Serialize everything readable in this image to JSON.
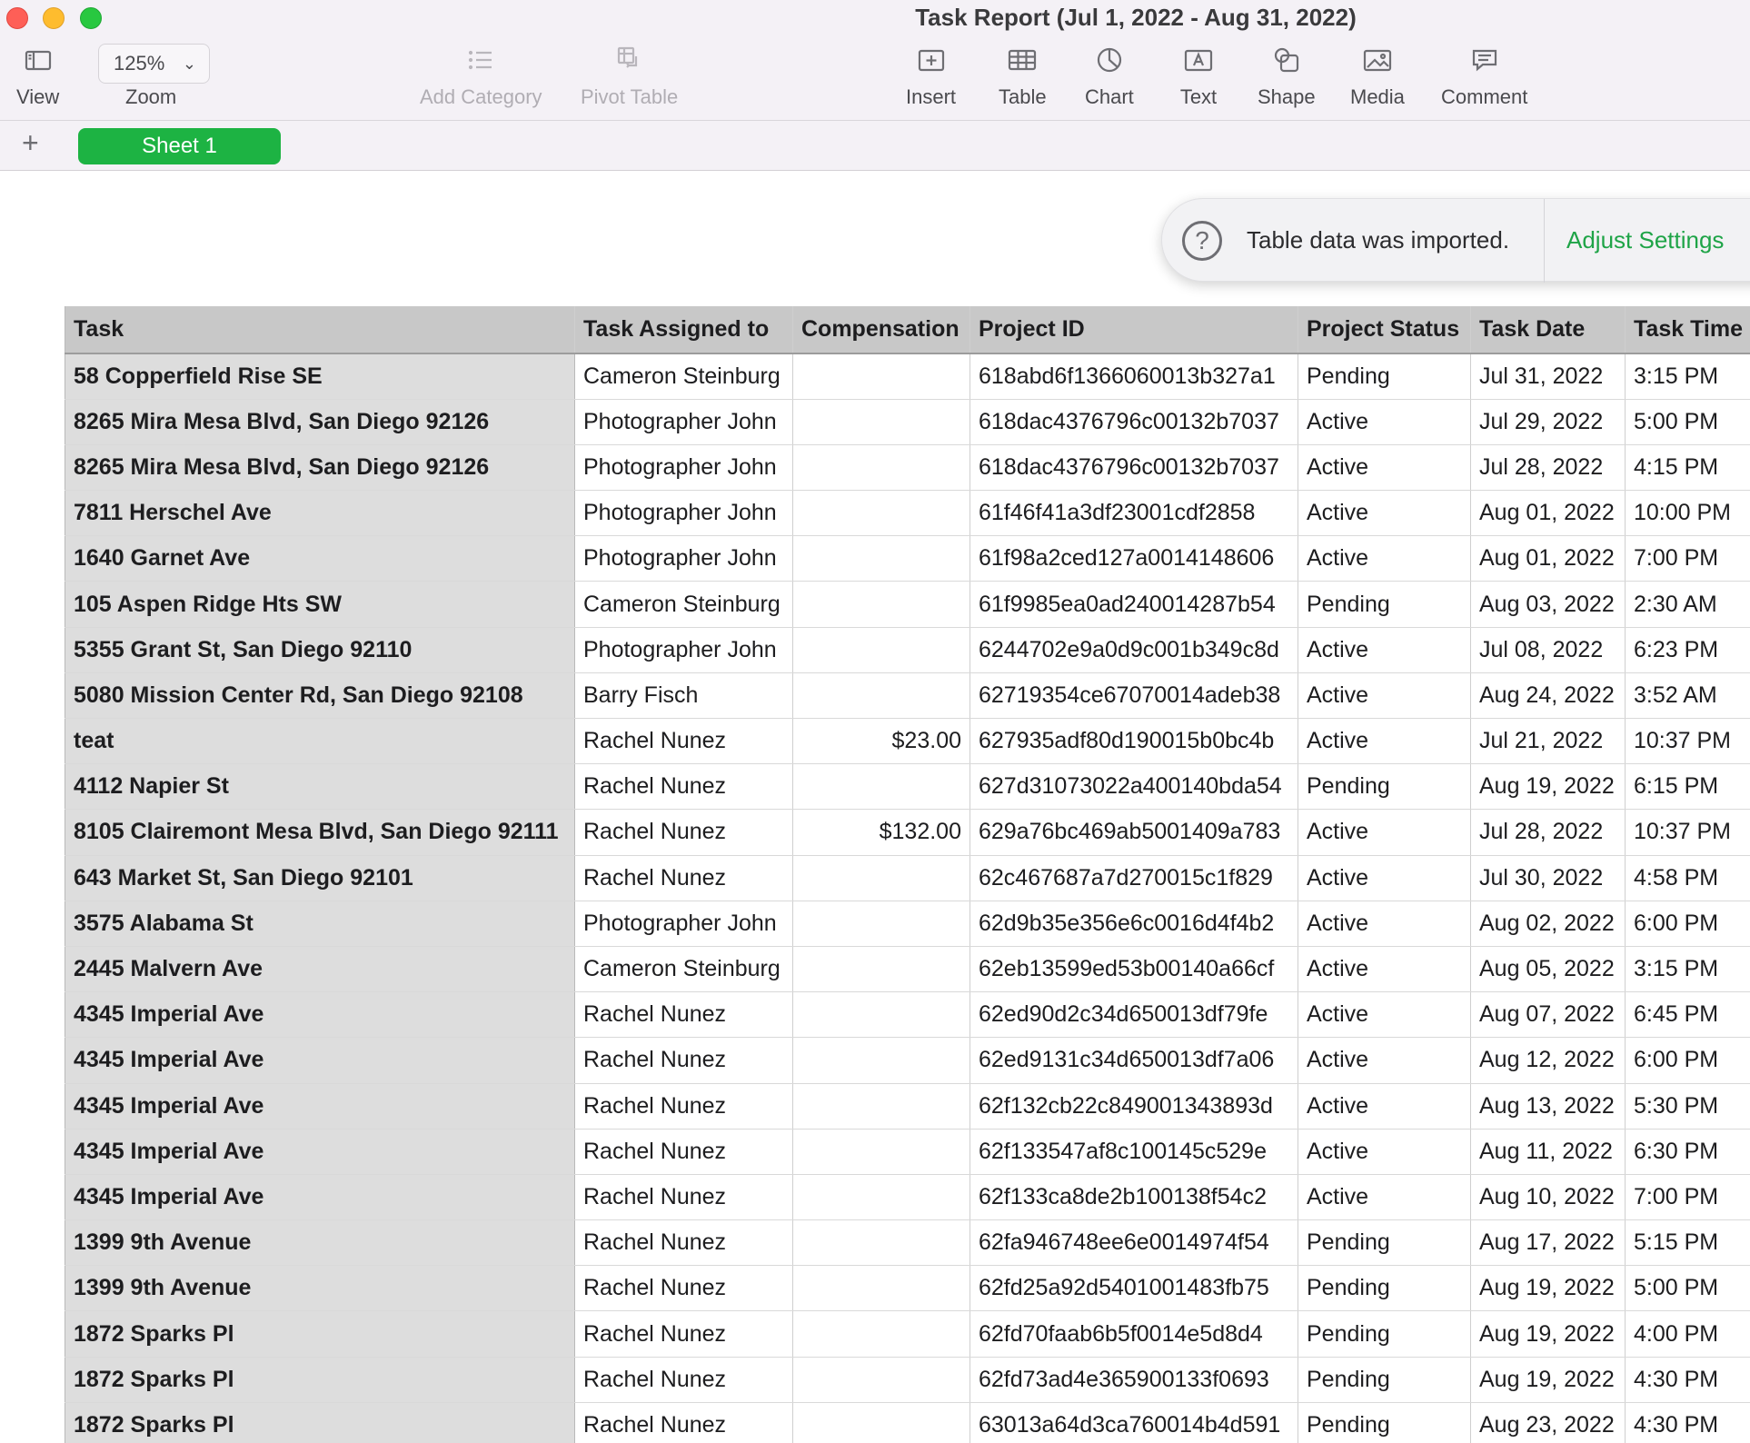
{
  "window": {
    "title": "Task Report (Jul 1, 2022 - Aug 31, 2022)"
  },
  "toolbar": {
    "view_label": "View",
    "zoom_value": "125%",
    "zoom_label": "Zoom",
    "add_category_label": "Add Category",
    "pivot_table_label": "Pivot Table",
    "insert_label": "Insert",
    "table_label": "Table",
    "chart_label": "Chart",
    "text_label": "Text",
    "shape_label": "Shape",
    "media_label": "Media",
    "comment_label": "Comment"
  },
  "sheets": {
    "add_symbol": "+",
    "active_tab": "Sheet 1",
    "active_color": "#1db343"
  },
  "notice": {
    "icon": "?",
    "message": "Table data was imported.",
    "action": "Adjust Settings"
  },
  "table": {
    "headers": [
      "Task",
      "Task Assigned to",
      "Compensation",
      "Project ID",
      "Project Status",
      "Task Date",
      "Task Time"
    ],
    "rows": [
      [
        "58 Copperfield Rise SE",
        "Cameron Steinburg",
        "",
        "618abd6f1366060013b327a1",
        "Pending",
        "Jul 31, 2022",
        "3:15 PM"
      ],
      [
        "8265 Mira Mesa Blvd, San Diego 92126",
        "Photographer John",
        "",
        "618dac4376796c00132b7037",
        "Active",
        "Jul 29, 2022",
        "5:00 PM"
      ],
      [
        "8265 Mira Mesa Blvd, San Diego 92126",
        "Photographer John",
        "",
        "618dac4376796c00132b7037",
        "Active",
        "Jul 28, 2022",
        "4:15 PM"
      ],
      [
        "7811 Herschel Ave",
        "Photographer John",
        "",
        "61f46f41a3df23001cdf2858",
        "Active",
        "Aug 01, 2022",
        "10:00 PM"
      ],
      [
        "1640 Garnet Ave",
        "Photographer John",
        "",
        "61f98a2ced127a0014148606",
        "Active",
        "Aug 01, 2022",
        "7:00 PM"
      ],
      [
        "105 Aspen Ridge Hts SW",
        "Cameron Steinburg",
        "",
        "61f9985ea0ad240014287b54",
        "Pending",
        "Aug 03, 2022",
        "2:30 AM"
      ],
      [
        "5355 Grant St, San Diego 92110",
        "Photographer John",
        "",
        "6244702e9a0d9c001b349c8d",
        "Active",
        "Jul 08, 2022",
        "6:23 PM"
      ],
      [
        "5080 Mission Center Rd, San Diego 92108",
        "Barry Fisch",
        "",
        "62719354ce67070014adeb38",
        "Active",
        "Aug 24, 2022",
        "3:52 AM"
      ],
      [
        "teat",
        "Rachel Nunez",
        "$23.00",
        "627935adf80d190015b0bc4b",
        "Active",
        "Jul 21, 2022",
        "10:37 PM"
      ],
      [
        "4112 Napier St",
        "Rachel Nunez",
        "",
        "627d31073022a400140bda54",
        "Pending",
        "Aug 19, 2022",
        "6:15 PM"
      ],
      [
        "8105 Clairemont Mesa Blvd, San Diego 92111",
        "Rachel Nunez",
        "$132.00",
        "629a76bc469ab5001409a783",
        "Active",
        "Jul 28, 2022",
        "10:37 PM"
      ],
      [
        "643 Market St, San Diego 92101",
        "Rachel Nunez",
        "",
        "62c467687a7d270015c1f829",
        "Active",
        "Jul 30, 2022",
        "4:58 PM"
      ],
      [
        "3575 Alabama St",
        "Photographer John",
        "",
        "62d9b35e356e6c0016d4f4b2",
        "Active",
        "Aug 02, 2022",
        "6:00 PM"
      ],
      [
        "2445 Malvern Ave",
        "Cameron Steinburg",
        "",
        "62eb13599ed53b00140a66cf",
        "Active",
        "Aug 05, 2022",
        "3:15 PM"
      ],
      [
        "4345 Imperial Ave",
        "Rachel Nunez",
        "",
        "62ed90d2c34d650013df79fe",
        "Active",
        "Aug 07, 2022",
        "6:45 PM"
      ],
      [
        "4345 Imperial Ave",
        "Rachel Nunez",
        "",
        "62ed9131c34d650013df7a06",
        "Active",
        "Aug 12, 2022",
        "6:00 PM"
      ],
      [
        "4345 Imperial Ave",
        "Rachel Nunez",
        "",
        "62f132cb22c849001343893d",
        "Active",
        "Aug 13, 2022",
        "5:30 PM"
      ],
      [
        "4345 Imperial Ave",
        "Rachel Nunez",
        "",
        "62f133547af8c100145c529e",
        "Active",
        "Aug 11, 2022",
        "6:30 PM"
      ],
      [
        "4345 Imperial Ave",
        "Rachel Nunez",
        "",
        "62f133ca8de2b100138f54c2",
        "Active",
        "Aug 10, 2022",
        "7:00 PM"
      ],
      [
        "1399 9th Avenue",
        "Rachel Nunez",
        "",
        "62fa946748ee6e0014974f54",
        "Pending",
        "Aug 17, 2022",
        "5:15 PM"
      ],
      [
        "1399 9th Avenue",
        "Rachel Nunez",
        "",
        "62fd25a92d5401001483fb75",
        "Pending",
        "Aug 19, 2022",
        "5:00 PM"
      ],
      [
        "1872 Sparks Pl",
        "Rachel Nunez",
        "",
        "62fd70faab6b5f0014e5d8d4",
        "Pending",
        "Aug 19, 2022",
        "4:00 PM"
      ],
      [
        "1872 Sparks Pl",
        "Rachel Nunez",
        "",
        "62fd73ad4e365900133f0693",
        "Pending",
        "Aug 19, 2022",
        "4:30 PM"
      ],
      [
        "1872 Sparks Pl",
        "Rachel Nunez",
        "",
        "63013a64d3ca760014b4d591",
        "Pending",
        "Aug 23, 2022",
        "4:30 PM"
      ]
    ]
  }
}
